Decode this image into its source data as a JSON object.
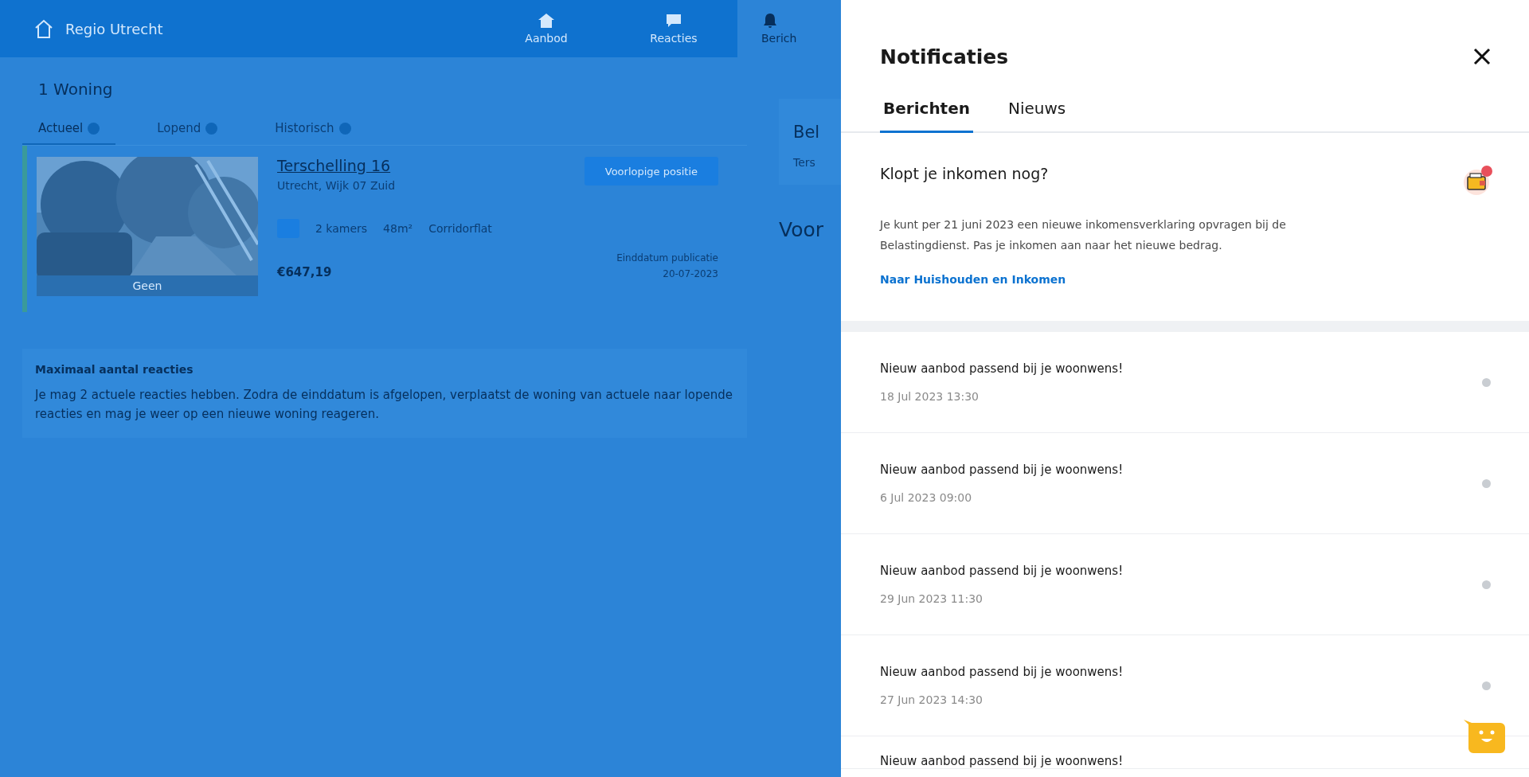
{
  "background_page": {
    "header": {
      "brand": "Regio Utrecht",
      "nav": [
        {
          "label": "Aanbod",
          "selected": false
        },
        {
          "label": "Reacties",
          "selected": false
        },
        {
          "label": "Berich",
          "selected": true
        }
      ]
    },
    "heading": "1 Woning",
    "tabs": [
      {
        "label": "Actueel",
        "selected": true
      },
      {
        "label": "Lopend",
        "selected": false
      },
      {
        "label": "Historisch",
        "selected": false
      }
    ],
    "listing": {
      "kind": "picture",
      "image_caption": "Geen",
      "title": "Terschelling 16",
      "subtitle": "Utrecht, Wijk 07 Zuid",
      "features": [
        "2 kamers",
        "48m²",
        "Corridorflat"
      ],
      "price": "€647,19",
      "position_button": "Voorlopige positie",
      "end_label": "Einddatum publicatie",
      "end_date": "20-07-2023"
    },
    "info": {
      "title": "Maximaal aantal reacties",
      "text": "Je mag 2 actuele reacties hebben. Zodra de einddatum is afgelopen, verplaatst de woning van actuele naar lopende reacties en mag je weer op een nieuwe woning reageren."
    },
    "side": {
      "card_title": "Bel",
      "card_text": "Ters",
      "section_title": "Voor"
    }
  },
  "panel": {
    "title": "Notificaties",
    "tabs": [
      {
        "label": "Berichten",
        "selected": true
      },
      {
        "label": "Nieuws",
        "selected": false
      }
    ],
    "featured": {
      "title": "Klopt je inkomen nog?",
      "text": "Je kunt per 21 juni 2023 een nieuwe inkomensverklaring opvragen bij de Belastingdienst. Pas je inkomen aan naar het nieuwe bedrag.",
      "link": "Naar Huishouden en Inkomen",
      "unread": true
    },
    "messages": [
      {
        "title": "Nieuw aanbod passend bij je woonwens!",
        "date": "18 Jul 2023 13:30",
        "unread": false
      },
      {
        "title": "Nieuw aanbod passend bij je woonwens!",
        "date": "6 Jul 2023 09:00",
        "unread": false
      },
      {
        "title": "Nieuw aanbod passend bij je woonwens!",
        "date": "29 Jun 2023 11:30",
        "unread": false
      },
      {
        "title": "Nieuw aanbod passend bij je woonwens!",
        "date": "27 Jun 2023 14:30",
        "unread": false
      },
      {
        "title": "Nieuw aanbod passend bij je woonwens!"
      }
    ]
  }
}
